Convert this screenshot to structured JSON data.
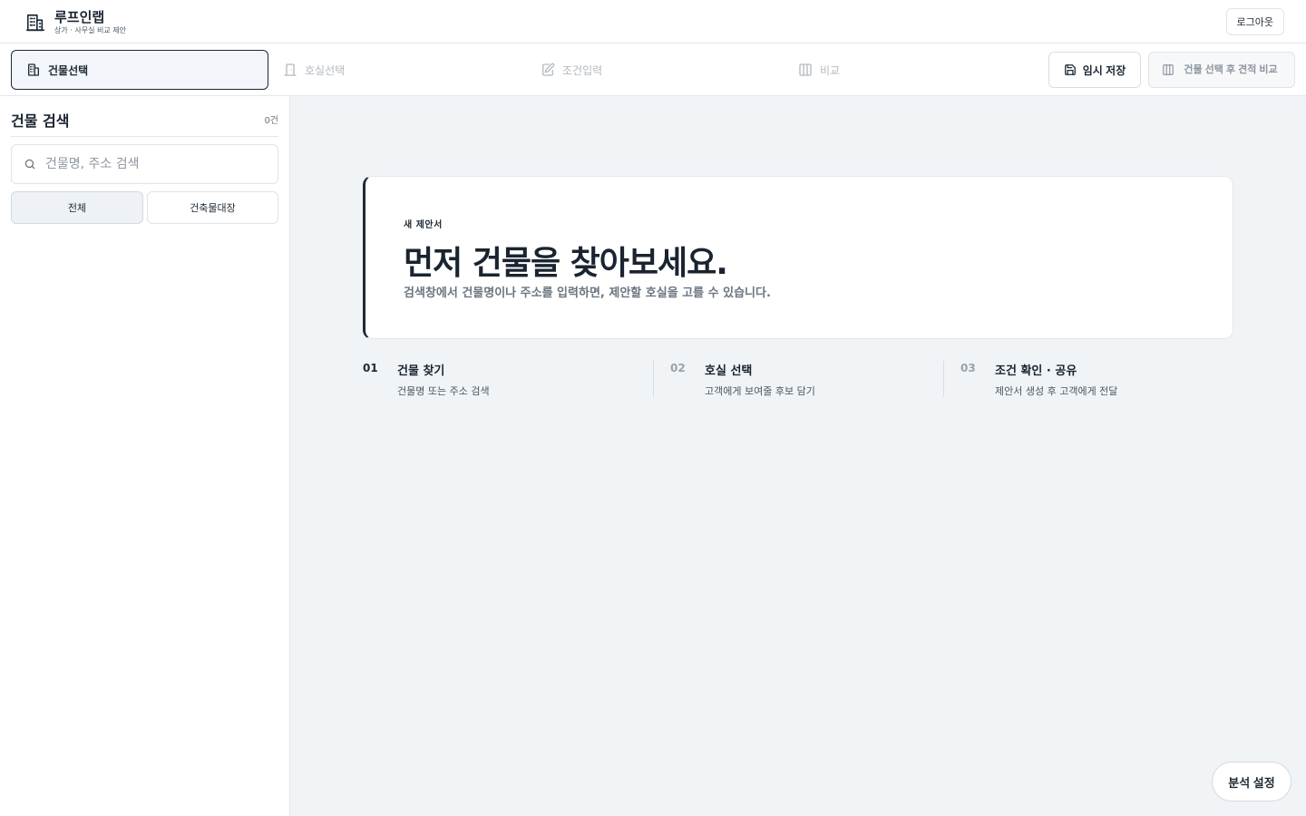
{
  "header": {
    "brand_title": "루프인랩",
    "brand_subtitle": "상가 · 사무실 비교 제안",
    "brand_icon": "building-icon",
    "logout_label": "로그아웃"
  },
  "steps": [
    {
      "label": "건물선택",
      "icon": "building-icon",
      "active": true
    },
    {
      "label": "호실선택",
      "icon": "door-icon",
      "active": false
    },
    {
      "label": "조건입력",
      "icon": "edit-icon",
      "active": false
    },
    {
      "label": "비교",
      "icon": "columns-icon",
      "active": false
    }
  ],
  "actions": {
    "save_label": "임시 저장",
    "compare_label": "건물 선택 후 견적 비교"
  },
  "sidebar": {
    "title": "건물 검색",
    "count": "0건",
    "search_placeholder": "건물명, 주소 검색",
    "filters": [
      {
        "label": "전체",
        "active": true
      },
      {
        "label": "건축물대장",
        "active": false
      }
    ]
  },
  "hero": {
    "eyebrow": "새 제안서",
    "title": "먼저 건물을 찾아보세요.",
    "description": "검색창에서 건물명이나 주소를 입력하면, 제안할 호실을 고를 수 있습니다."
  },
  "guide": [
    {
      "num": "01",
      "title": "건물 찾기",
      "desc": "건물명 또는 주소 검색"
    },
    {
      "num": "02",
      "title": "호실 선택",
      "desc": "고객에게 보여줄 후보 담기"
    },
    {
      "num": "03",
      "title": "조건 확인 · 공유",
      "desc": "제안서 생성 후 고객에게 전달"
    }
  ],
  "analysis_label": "분석 설정",
  "colors": {
    "primary": "#1e2a36",
    "muted": "#b3bac2",
    "background": "#f0f4f7",
    "border": "#e3e7ec"
  }
}
